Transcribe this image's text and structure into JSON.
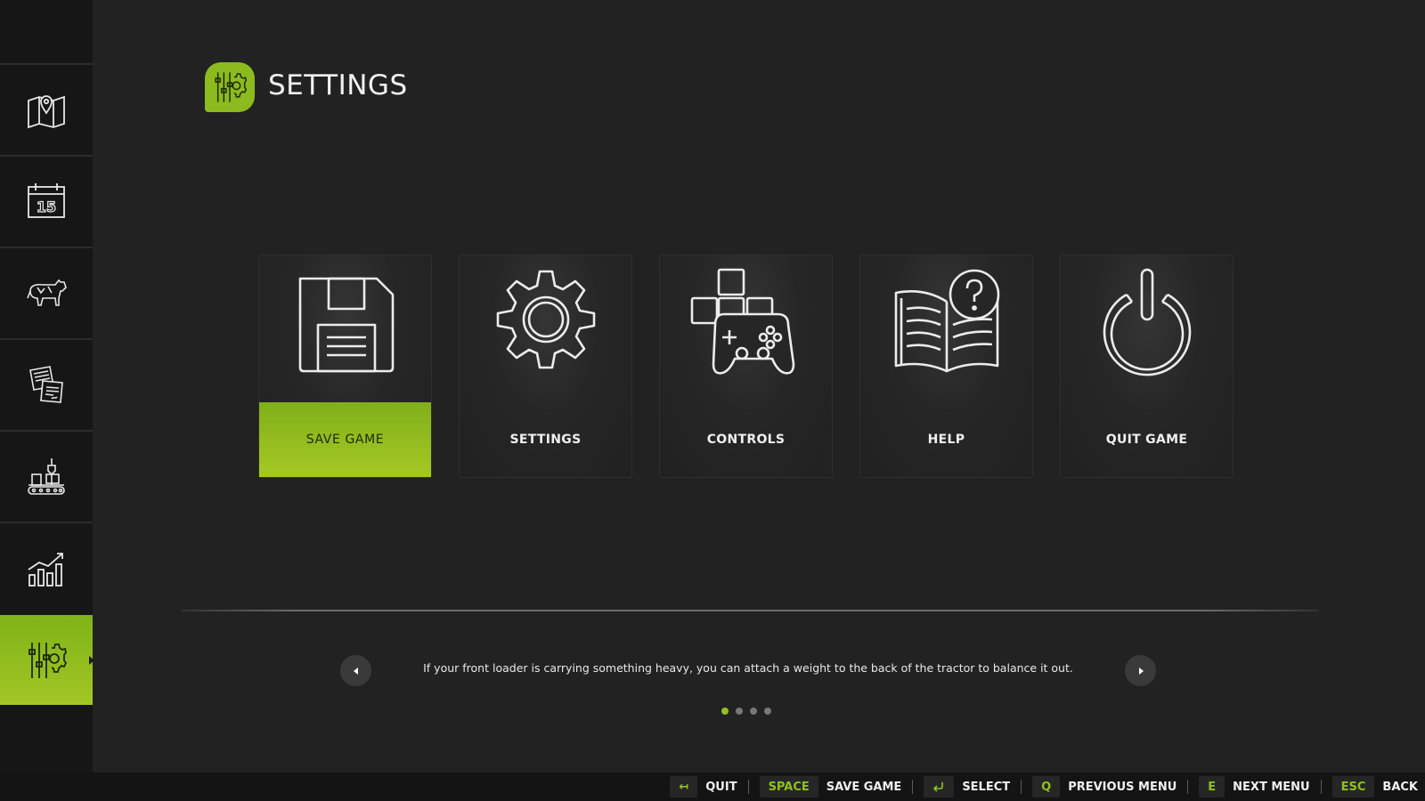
{
  "sidebar": {
    "items": [
      {
        "icon": "map-pin-icon"
      },
      {
        "icon": "calendar-icon",
        "date_number": "15"
      },
      {
        "icon": "cow-icon"
      },
      {
        "icon": "contracts-icon"
      },
      {
        "icon": "production-icon"
      },
      {
        "icon": "statistics-icon"
      },
      {
        "icon": "settings-sliders-icon",
        "active": true
      }
    ]
  },
  "header": {
    "title": "SETTINGS",
    "icon": "settings-sliders-icon"
  },
  "menu": {
    "cards": [
      {
        "label": "SAVE GAME",
        "icon": "floppy-disk-icon",
        "selected": true
      },
      {
        "label": "SETTINGS",
        "icon": "gear-icon"
      },
      {
        "label": "CONTROLS",
        "icon": "gamepad-icon"
      },
      {
        "label": "HELP",
        "icon": "help-book-icon"
      },
      {
        "label": "QUIT GAME",
        "icon": "power-icon"
      }
    ]
  },
  "tip": {
    "text": "If your front loader is carrying something heavy, you can attach a weight to the back of the tractor to balance it out.",
    "page_count": 4,
    "active_page": 1
  },
  "footer": {
    "hints": [
      {
        "key": "↤",
        "label": "QUIT"
      },
      {
        "key": "SPACE",
        "label": "SAVE GAME"
      },
      {
        "key_icon": "enter-key-icon",
        "label": "SELECT"
      },
      {
        "key": "Q",
        "label": "PREVIOUS MENU"
      },
      {
        "key": "E",
        "label": "NEXT MENU"
      },
      {
        "key": "ESC",
        "label": "BACK"
      }
    ]
  },
  "colors": {
    "accent": "#95c11f",
    "background": "#222222",
    "sidebar": "#161616",
    "footer": "#141414"
  }
}
